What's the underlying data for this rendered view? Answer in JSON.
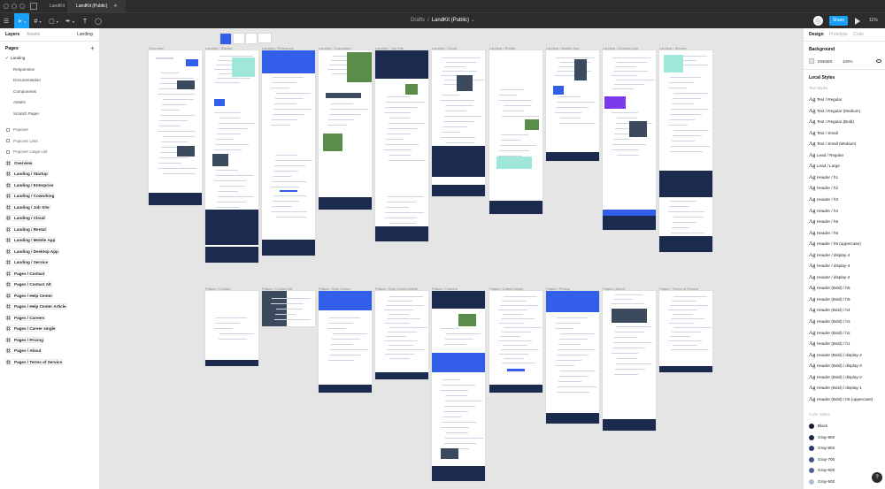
{
  "titlebar": {
    "tabs": [
      {
        "label": "LandKit",
        "active": false
      },
      {
        "label": "LandKit (Public)",
        "active": true
      }
    ],
    "close_glyph": "×",
    "add_glyph": "+"
  },
  "toolbar": {
    "breadcrumb_parent": "Drafts",
    "breadcrumb_sep": "/",
    "file_name": "LandKit (Public)",
    "file_caret": "⌄",
    "share_label": "Share",
    "zoom_label": "11%",
    "tools": [
      {
        "name": "menu-icon",
        "glyph": "☰",
        "caret": false
      },
      {
        "name": "move-tool-icon",
        "glyph": "➤",
        "caret": true
      },
      {
        "name": "frame-tool-icon",
        "glyph": "#",
        "caret": true
      },
      {
        "name": "shape-tool-icon",
        "glyph": "▢",
        "caret": true
      },
      {
        "name": "pen-tool-icon",
        "glyph": "✒",
        "caret": true
      },
      {
        "name": "text-tool-icon",
        "glyph": "T",
        "caret": false
      },
      {
        "name": "comment-tool-icon",
        "glyph": "◯",
        "caret": false
      }
    ]
  },
  "left_panel": {
    "tab_layers": "Layers",
    "tab_assets": "Assets",
    "current_page": "Landing",
    "pages_header": "Pages",
    "pages_add": "+",
    "pages": [
      {
        "label": "Landing",
        "checked": true,
        "sub": false
      },
      {
        "label": "Responsive",
        "checked": false,
        "sub": true
      },
      {
        "label": "Documentation",
        "checked": false,
        "sub": true
      },
      {
        "label": "Components",
        "checked": false,
        "sub": true
      },
      {
        "label": "Assets",
        "checked": false,
        "sub": true
      },
      {
        "label": "Scratch Paper",
        "checked": false,
        "sub": true
      }
    ],
    "layers": [
      {
        "label": "Popover",
        "kind": "component"
      },
      {
        "label": "Popover Lists",
        "kind": "component"
      },
      {
        "label": "Popover Large List",
        "kind": "component"
      },
      {
        "label": "Overview",
        "kind": "frame"
      },
      {
        "label": "Landing / Startup",
        "kind": "frame"
      },
      {
        "label": "Landing / Enterprise",
        "kind": "frame"
      },
      {
        "label": "Landing / Coworking",
        "kind": "frame"
      },
      {
        "label": "Landing / Job Site",
        "kind": "frame"
      },
      {
        "label": "Landing / Cloud",
        "kind": "frame"
      },
      {
        "label": "Landing / Rental",
        "kind": "frame"
      },
      {
        "label": "Landing / Mobile App",
        "kind": "frame"
      },
      {
        "label": "Landing / Desktop App",
        "kind": "frame"
      },
      {
        "label": "Landing / Service",
        "kind": "frame"
      },
      {
        "label": "Pages / Contact",
        "kind": "frame"
      },
      {
        "label": "Pages / Contact Alt",
        "kind": "frame"
      },
      {
        "label": "Pages / Help Center",
        "kind": "frame"
      },
      {
        "label": "Pages / Help Center Article",
        "kind": "frame"
      },
      {
        "label": "Pages / Careers",
        "kind": "frame"
      },
      {
        "label": "Pages / Career single",
        "kind": "frame"
      },
      {
        "label": "Pages / Pricing",
        "kind": "frame"
      },
      {
        "label": "Pages / About",
        "kind": "frame"
      },
      {
        "label": "Pages / Terms of Service",
        "kind": "frame"
      }
    ]
  },
  "canvas": {
    "row1": [
      {
        "label": "Overview",
        "style": "overview"
      },
      {
        "label": "Landing / Startup",
        "style": "startup"
      },
      {
        "label": "Landing / Enterprise",
        "style": "enterprise"
      },
      {
        "label": "Landing / Coworking",
        "style": "coworking"
      },
      {
        "label": "Landing / Job Site",
        "style": "jobsite"
      },
      {
        "label": "Landing / Cloud",
        "style": "cloud"
      },
      {
        "label": "Landing / Rental",
        "style": "rental"
      },
      {
        "label": "Landing / Mobile App",
        "style": "mobile"
      },
      {
        "label": "Landing / Desktop App",
        "style": "desktop"
      },
      {
        "label": "Landing / Service",
        "style": "service"
      }
    ],
    "row2": [
      {
        "label": "Pages / Contact",
        "style": "contact"
      },
      {
        "label": "Pages / Contact Alt",
        "style": "contactalt"
      },
      {
        "label": "Pages / Help Center",
        "style": "help"
      },
      {
        "label": "Pages / Help Center Article",
        "style": "article"
      },
      {
        "label": "Pages / Careers",
        "style": "careers"
      },
      {
        "label": "Pages / Career single",
        "style": "career_single"
      },
      {
        "label": "Pages / Pricing",
        "style": "pricing"
      },
      {
        "label": "Pages / About",
        "style": "about"
      },
      {
        "label": "Pages / Terms of Service",
        "style": "terms"
      }
    ]
  },
  "right_panel": {
    "tabs": [
      {
        "label": "Design",
        "active": true
      },
      {
        "label": "Prototype",
        "active": false
      },
      {
        "label": "Code",
        "active": false
      }
    ],
    "background_header": "Background",
    "background_hex": "E5E5E5",
    "background_opacity": "100%",
    "local_styles_header": "Local Styles",
    "text_styles_group": "Text Styles",
    "text_styles": [
      "Text / Regular",
      "Text / Regular (Medium)",
      "Text / Regular (Bold)",
      "Text / Small",
      "Text / Small (Medium)",
      "Lead / Regular",
      "Lead / Large",
      "Header / h1",
      "Header / h2",
      "Header / h3",
      "Header / h4",
      "Header / h5",
      "Header / h6",
      "Header / h6 (uppercase)",
      "Header / display-4",
      "Header / display-3",
      "Header / display-2",
      "Header (Bold) / h6",
      "Header (Bold) / h5",
      "Header (Bold) / h4",
      "Header (Bold) / h3",
      "Header (Bold) / h2",
      "Header (Bold) / h1",
      "Header (Bold) / display-4",
      "Header (Bold) / display-3",
      "Header (Bold) / display-2",
      "Header (Bold) / display-1",
      "Header (Bold) / h6 (uppercase)"
    ],
    "ag_glyph": "Ag",
    "color_styles_group": "Color Styles",
    "color_styles": [
      {
        "label": "Black",
        "color": "#161c2d"
      },
      {
        "label": "Gray-900",
        "color": "#1b2a4e"
      },
      {
        "label": "Gray-800",
        "color": "#283c6d"
      },
      {
        "label": "Gray-700",
        "color": "#3d5491"
      },
      {
        "label": "Gray-600",
        "color": "#506690"
      },
      {
        "label": "Gray-500",
        "color": "#abbcd5"
      }
    ],
    "help_label": "?"
  },
  "colors": {
    "accent": "#18a0fb",
    "brand_blue": "#335eea",
    "brand_dark": "#1b2a4e",
    "chrome": "#2c2c2c",
    "canvas": "#e5e5e5"
  }
}
